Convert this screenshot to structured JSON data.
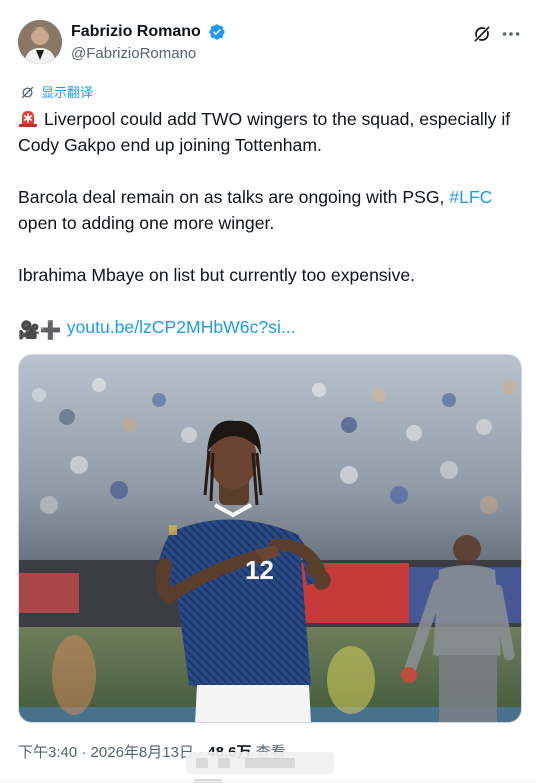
{
  "author": {
    "display_name": "Fabrizio Romano",
    "handle": "@FabrizioRomano",
    "verified": true,
    "avatar_icon": "profile-photo"
  },
  "actions": {
    "grok_icon": "grok-icon",
    "more_icon": "more-options-icon"
  },
  "translate_label": "显示翻译",
  "tweet": {
    "line1_emoji": "rotating-light-emoji",
    "line1_text": "Liverpool could add TWO wingers to the squad, especially if Cody Gakpo end up joining Tottenham.",
    "line2_text": "Barcola deal remain on as talks are ongoing with PSG,",
    "line2_hashtag": "#LFC",
    "line2_rest": "open to adding one more winger.",
    "line3_text": "Ibrahima Mbaye on list but currently too expensive.",
    "line4_emojis": "🎥➕",
    "link_text": "youtu.be/lzCP2MHbW6c?si..."
  },
  "media": {
    "jersey_number": "12",
    "background_color": "#2a4a86"
  },
  "footer": {
    "time": "下午3:40",
    "separator": "·",
    "date": "2026年8月13日",
    "views_count": "48.6万",
    "views_label": "查看"
  },
  "colors": {
    "accent": "#1d9bf0",
    "muted": "#536471",
    "text": "#0f1419"
  }
}
